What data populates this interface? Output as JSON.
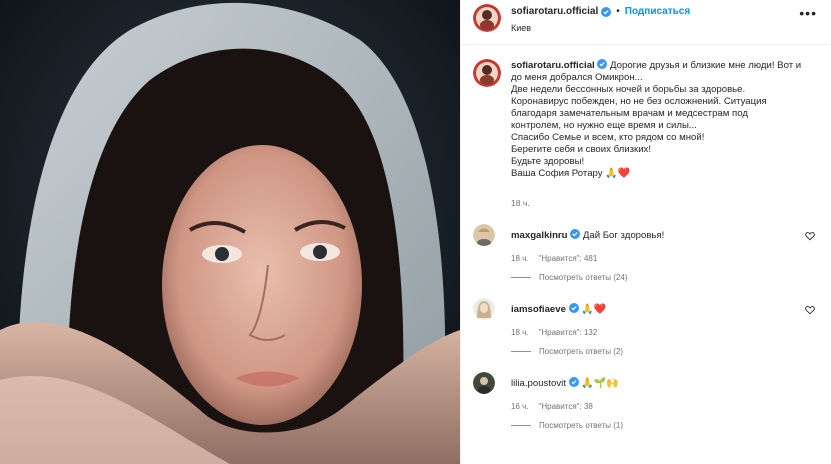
{
  "post": {
    "author": "sofiarotaru.official",
    "follow_label": "Подписаться",
    "location": "Киев",
    "more_label": "•••"
  },
  "caption": {
    "author": "sofiarotaru.official",
    "lines": [
      "Дорогие друзья и близкие мне люди! Вот и",
      "до меня добрался Омикрон...",
      "Две недели бессонных ночей и борьбы за здоровье.",
      "Коронавирус побежден, но не без осложнений. Ситуация",
      "благодаря замечательным врачам и медсестрам под",
      "контролем, но нужно еще время и силы...",
      "Спасибо Семье и всем, кто рядом со мной!",
      "Берегите себя и своих близких!",
      "Будьте здоровы!",
      "Ваша София Ротару"
    ],
    "emoji_end": "🙏❤️",
    "time": "18 ч."
  },
  "comments": [
    {
      "user": "maxgalkinru",
      "text": "Дай Бог здоровья!",
      "time": "18 ч.",
      "likes": "\"Нравится\": 481",
      "replies": "Посмотреть ответы (24)"
    },
    {
      "user": "iamsofiaeve",
      "text": "🙏❤️",
      "time": "18 ч.",
      "likes": "\"Нравится\": 132",
      "replies": "Посмотреть ответы (2)"
    },
    {
      "user": "lilia.poustovit",
      "text": "🙏🌱🙌",
      "time": "16 ч.",
      "likes": "\"Нравится\": 38",
      "replies": "Посмотреть ответы (1)"
    }
  ],
  "colors": {
    "accent": "#0095f6",
    "verified": "#3897f0",
    "heart": "#e0245e"
  }
}
